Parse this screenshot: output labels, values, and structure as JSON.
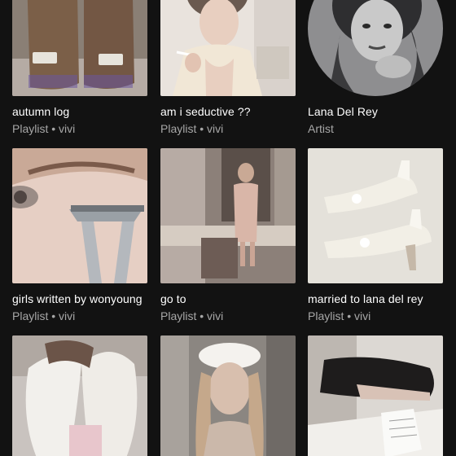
{
  "items": [
    {
      "title": "autumn log",
      "subtitle": "Playlist • vivi",
      "art": "ugg-boots-photo"
    },
    {
      "title": "am i seductive ??",
      "subtitle": "Playlist • vivi",
      "art": "woman-smoking-photo"
    },
    {
      "title": "Lana Del Rey",
      "subtitle": "Artist",
      "art": "lana-del-rey-portrait"
    },
    {
      "title": "girls written by wonyoung",
      "subtitle": "Playlist • vivi",
      "art": "eyelash-curler-photo"
    },
    {
      "title": "go to",
      "subtitle": "Playlist • vivi",
      "art": "vanity-room-photo"
    },
    {
      "title": "married to lana del rey",
      "subtitle": "Playlist • vivi",
      "art": "white-heels-photo"
    },
    {
      "title": "",
      "subtitle": "",
      "art": "angel-wings-photo"
    },
    {
      "title": "",
      "subtitle": "",
      "art": "beret-woman-photo"
    },
    {
      "title": "",
      "subtitle": "",
      "art": "girl-on-bed-photo"
    }
  ],
  "colors": {
    "background": "#121212",
    "title": "#ffffff",
    "subtitle": "#a7a7a7"
  }
}
